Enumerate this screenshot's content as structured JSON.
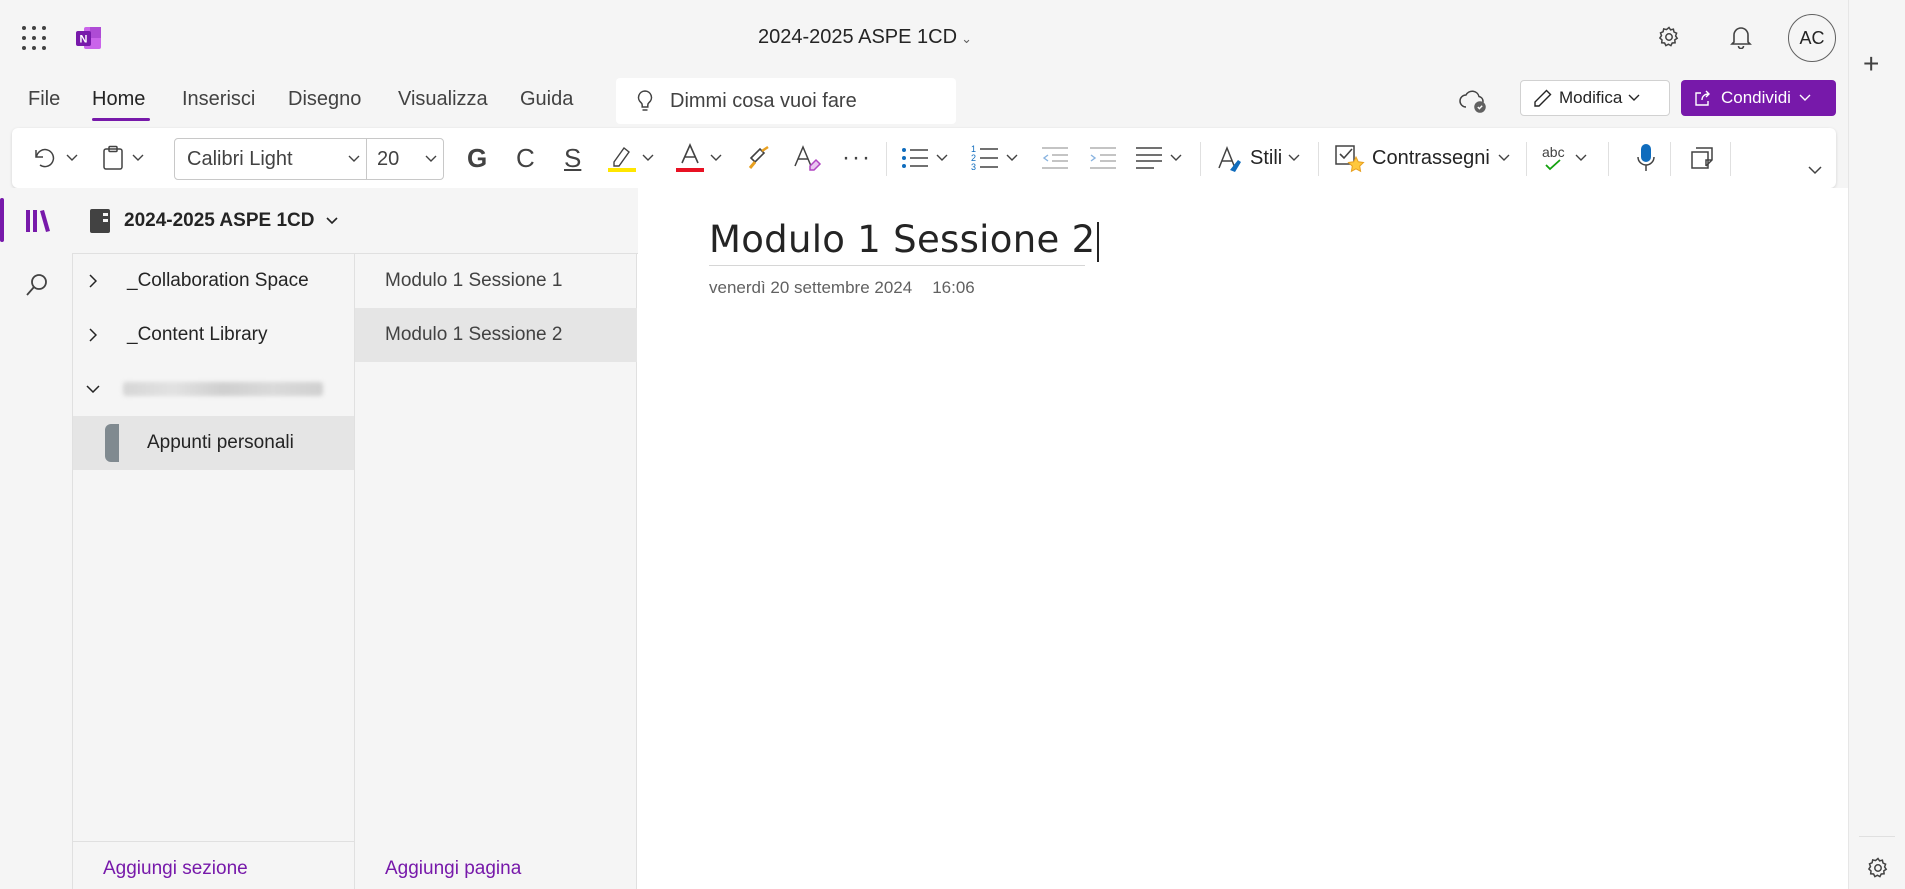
{
  "titlebar": {
    "document_title": "2024-2025 ASPE 1CD",
    "avatar_initials": "AC"
  },
  "menu": {
    "tabs": [
      "File",
      "Home",
      "Inserisci",
      "Disegno",
      "Visualizza",
      "Guida"
    ],
    "active_tab": "Home",
    "tell_me_placeholder": "Dimmi cosa vuoi fare",
    "edit_label": "Modifica",
    "share_label": "Condividi"
  },
  "ribbon": {
    "font_name": "Calibri Light",
    "font_size": "20",
    "bold": "G",
    "italic": "C",
    "strike": "S",
    "styles_label": "Stili",
    "tags_label": "Contrassegni",
    "spell_label": "abc"
  },
  "notebook": {
    "name": "2024-2025 ASPE 1CD",
    "sections": [
      {
        "label": "_Collaboration Space",
        "expanded": false
      },
      {
        "label": "_Content Library",
        "expanded": false
      }
    ],
    "sub_section": "Appunti personali",
    "add_section": "Aggiungi sezione"
  },
  "pages": {
    "items": [
      "Modulo 1 Sessione 1",
      "Modulo 1 Sessione 2"
    ],
    "active_index": 1,
    "add_page": "Aggiungi pagina"
  },
  "canvas": {
    "title": "Modulo 1 Sessione 2",
    "date": "venerdì 20 settembre 2024",
    "time": "16:06"
  },
  "colors": {
    "accent": "#7719aa",
    "highlight": "#ffe600",
    "font_color": "#e81123"
  }
}
